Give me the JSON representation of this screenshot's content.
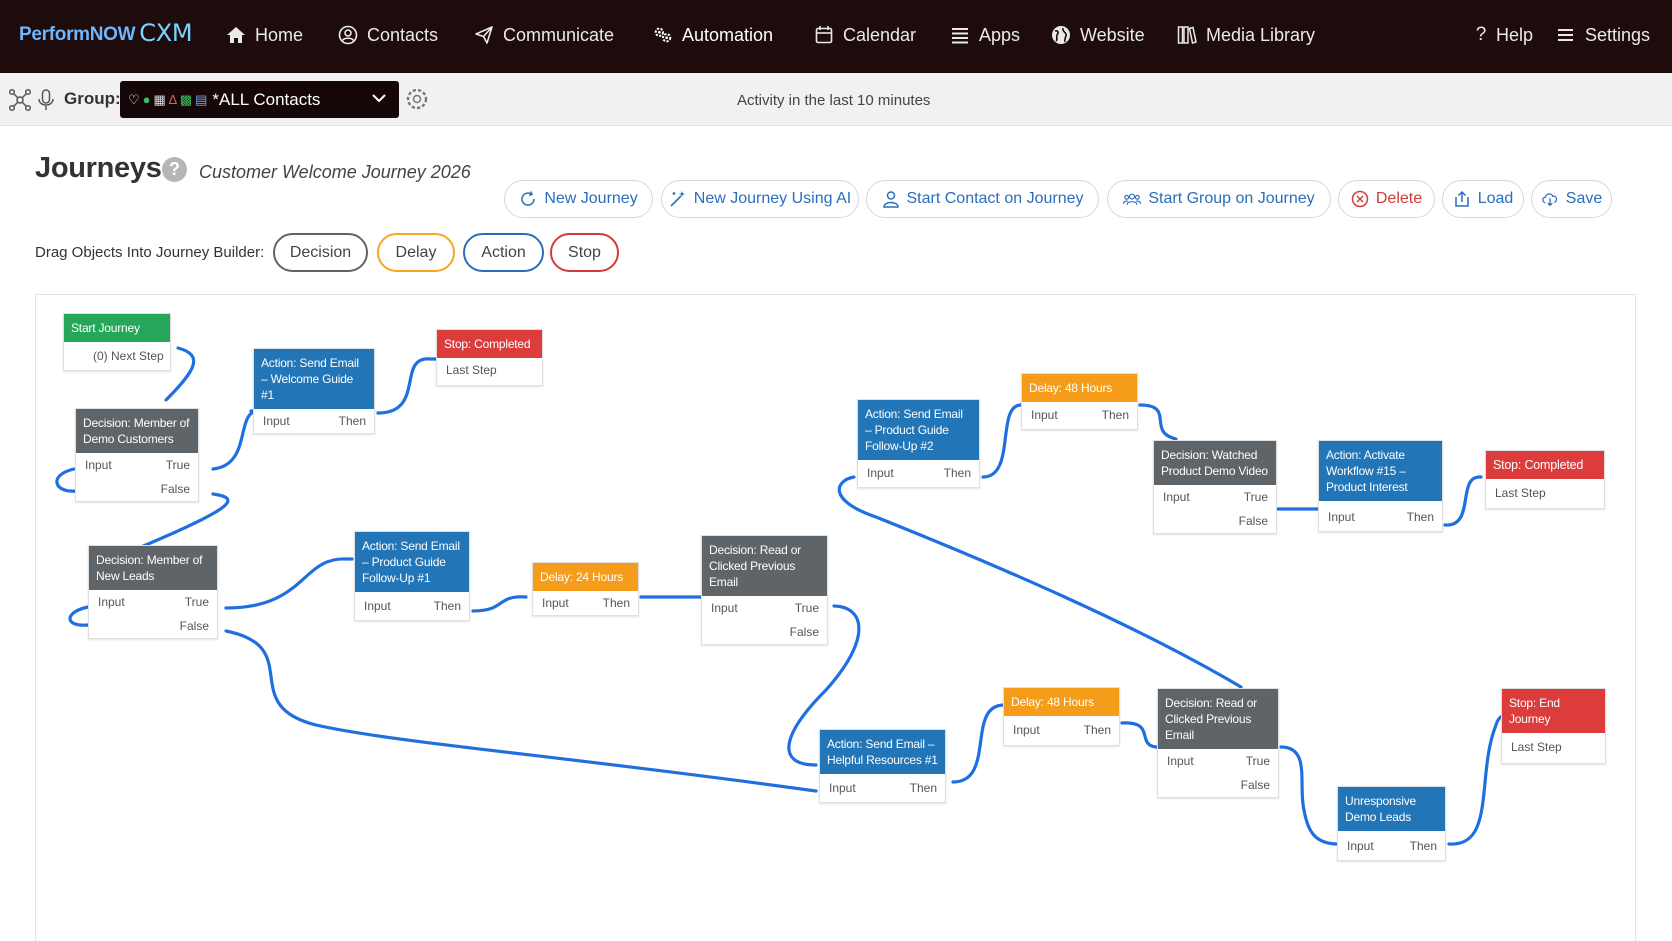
{
  "app": {
    "brand": "PerformNOW",
    "brand_suffix": "CXM"
  },
  "nav": {
    "home": "Home",
    "contacts": "Contacts",
    "communicate": "Communicate",
    "automation": "Automation",
    "calendar": "Calendar",
    "apps": "Apps",
    "website": "Website",
    "media_library": "Media Library",
    "help": "Help",
    "settings": "Settings"
  },
  "groupbar": {
    "label": "Group:",
    "selected": "*ALL Contacts",
    "activity": "Activity in the last 10 minutes"
  },
  "header": {
    "title": "Journeys",
    "help": "?",
    "journey_name": "Customer Welcome Journey 2026"
  },
  "toolbar": {
    "new_journey": "New Journey",
    "new_journey_ai": "New Journey Using AI",
    "start_contact": "Start Contact on Journey",
    "start_group": "Start Group on Journey",
    "delete": "Delete",
    "load": "Load",
    "save": "Save"
  },
  "palette": {
    "label": "Drag Objects Into Journey Builder:",
    "decision": "Decision",
    "delay": "Delay",
    "action": "Action",
    "stop": "Stop"
  },
  "colors": {
    "start": "#26a65b",
    "decision": "#5f6469",
    "action": "#2275b6",
    "delay": "#f59c1a",
    "stop": "#dc3c3c",
    "connector": "#1f6fe0"
  },
  "nodes": {
    "start": {
      "title": "Start Journey",
      "out": "(0) Next Step"
    },
    "dec_demo": {
      "title": "Decision: Member of Demo Customers",
      "in": "Input",
      "true": "True",
      "false": "False"
    },
    "act_welcome": {
      "title": "Action: Send Email – Welcome Guide #1",
      "in": "Input",
      "then": "Then"
    },
    "stop1": {
      "title": "Stop: Completed",
      "out": "Last Step"
    },
    "dec_leads": {
      "title": "Decision: Member of New Leads",
      "in": "Input",
      "true": "True",
      "false": "False"
    },
    "act_product1": {
      "title": "Action: Send Email – Product Guide Follow-Up #1",
      "in": "Input",
      "then": "Then"
    },
    "delay24": {
      "title": "Delay: 24 Hours",
      "in": "Input",
      "then": "Then"
    },
    "dec_read1": {
      "title": "Decision: Read or Clicked Previous Email",
      "in": "Input",
      "true": "True",
      "false": "False"
    },
    "act_product2": {
      "title": "Action: Send Email – Product Guide Follow-Up #2",
      "in": "Input",
      "then": "Then"
    },
    "delay48a": {
      "title": "Delay: 48 Hours",
      "in": "Input",
      "then": "Then"
    },
    "dec_watched": {
      "title": "Decision: Watched Product Demo Video",
      "in": "Input",
      "true": "True",
      "false": "False"
    },
    "act_workflow": {
      "title": "Action: Activate Workflow #15 – Product Interest",
      "in": "Input",
      "then": "Then"
    },
    "stop2": {
      "title": "Stop: Completed",
      "out": "Last Step"
    },
    "act_helpful": {
      "title": "Action: Send Email – Helpful Resources #1",
      "in": "Input",
      "then": "Then"
    },
    "delay48b": {
      "title": "Delay: 48 Hours",
      "in": "Input",
      "then": "Then"
    },
    "dec_read2": {
      "title": "Decision: Read or Clicked Previous Email",
      "in": "Input",
      "true": "True",
      "false": "False"
    },
    "unresponsive": {
      "title": "Unresponsive Demo Leads",
      "in": "Input",
      "then": "Then"
    },
    "stop3": {
      "title": "Stop: End Journey",
      "out": "Last Step"
    }
  }
}
